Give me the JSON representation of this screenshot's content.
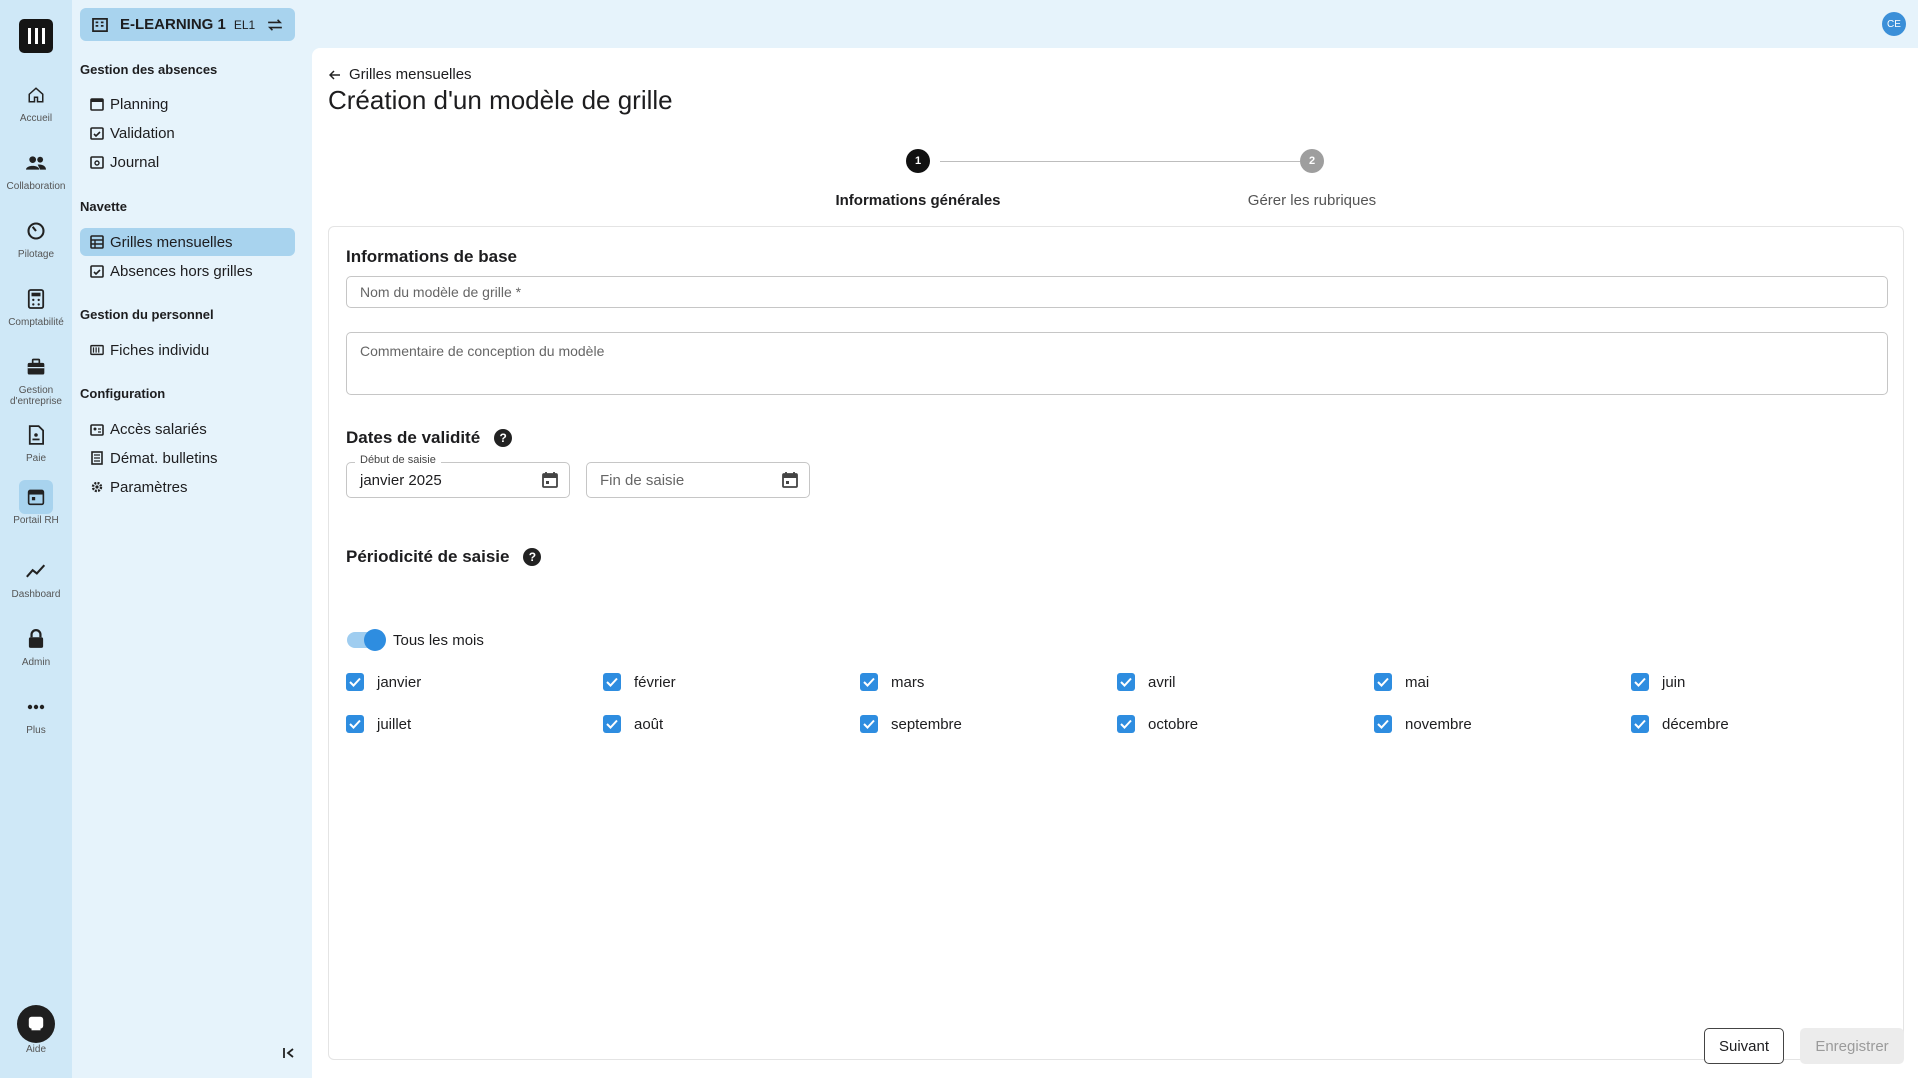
{
  "rail": {
    "items": [
      {
        "label": "Accueil",
        "icon": "home-icon"
      },
      {
        "label": "Collaboration",
        "icon": "people-icon"
      },
      {
        "label": "Pilotage",
        "icon": "gauge-icon"
      },
      {
        "label": "Comptabilité",
        "icon": "calculator-icon"
      },
      {
        "label": "Gestion d'entreprise",
        "icon": "briefcase-icon"
      },
      {
        "label": "Paie",
        "icon": "document-icon"
      },
      {
        "label": "Portail RH",
        "icon": "calendar-icon"
      },
      {
        "label": "Dashboard",
        "icon": "trend-icon"
      },
      {
        "label": "Admin",
        "icon": "lock-icon"
      },
      {
        "label": "Plus",
        "icon": "more-icon"
      }
    ],
    "help_label": "Aide"
  },
  "company": {
    "name": "E-LEARNING 1",
    "code": "EL1"
  },
  "sidebar": {
    "sections": [
      {
        "title": "Gestion des absences",
        "items": [
          "Planning",
          "Validation",
          "Journal"
        ]
      },
      {
        "title": "Navette",
        "items": [
          "Grilles mensuelles",
          "Absences hors grilles"
        ]
      },
      {
        "title": "Gestion du personnel",
        "items": [
          "Fiches individu"
        ]
      },
      {
        "title": "Configuration",
        "items": [
          "Accès salariés",
          "Démat. bulletins",
          "Paramètres"
        ]
      }
    ],
    "active_item": "Grilles mensuelles"
  },
  "user": {
    "initials": "CE"
  },
  "page": {
    "back_label": "Grilles mensuelles",
    "title": "Création d'un modèle de grille"
  },
  "stepper": {
    "steps": [
      {
        "number": "1",
        "label": "Informations générales"
      },
      {
        "number": "2",
        "label": "Gérer les rubriques"
      }
    ]
  },
  "form": {
    "section_base": "Informations de base",
    "name_placeholder": "Nom du modèle de grille *",
    "comment_placeholder": "Commentaire de conception du modèle",
    "section_dates": "Dates de validité",
    "start_label": "Début de saisie",
    "start_value": "janvier 2025",
    "end_placeholder": "Fin de saisie",
    "section_period": "Périodicité de saisie",
    "toggle_label": "Tous les mois",
    "months": [
      "janvier",
      "février",
      "mars",
      "avril",
      "mai",
      "juin",
      "juillet",
      "août",
      "septembre",
      "octobre",
      "novembre",
      "décembre"
    ]
  },
  "actions": {
    "next": "Suivant",
    "save": "Enregistrer"
  },
  "colors": {
    "accent": "#2e8de0",
    "sidebar_bg": "#e6f3fb",
    "rail_bg": "#cfe8f7",
    "active_bg": "#a8d3ee"
  }
}
